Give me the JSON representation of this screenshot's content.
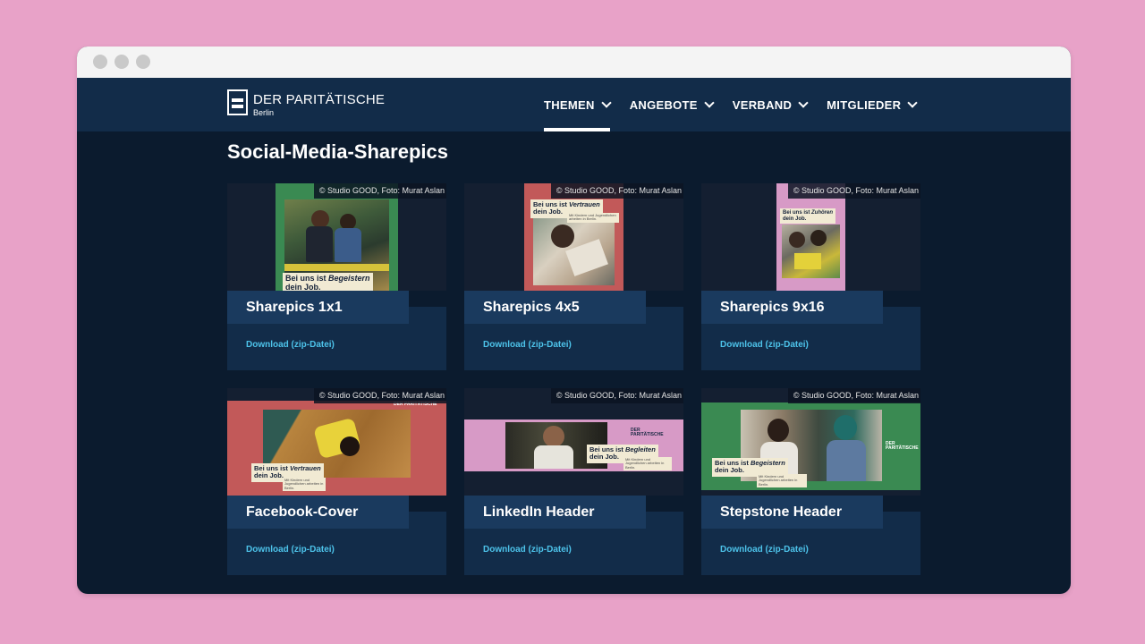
{
  "header": {
    "logo_name": "DER PARITÄTISCHE",
    "logo_sub": "Berlin"
  },
  "nav": [
    {
      "label": "THEMEN"
    },
    {
      "label": "ANGEBOTE"
    },
    {
      "label": "VERBAND"
    },
    {
      "label": "MITGLIEDER"
    }
  ],
  "page": {
    "title": "Social-Media-Sharepics"
  },
  "cards": [
    {
      "title": "Sharepics 1x1",
      "download": "Download (zip-Datei)",
      "credit": "© Studio GOOD, Foto: Murat Aslan",
      "tag_pre": "Bei uns ist ",
      "tag_em": "Begeistern",
      "tag_post": "dein Job."
    },
    {
      "title": "Sharepics 4x5",
      "download": "Download (zip-Datei)",
      "credit": "© Studio GOOD, Foto: Murat Aslan",
      "tag_pre": "Bei uns ist ",
      "tag_em": "Vertrauen",
      "tag_post": "dein Job."
    },
    {
      "title": "Sharepics 9x16",
      "download": "Download (zip-Datei)",
      "credit": "© Studio GOOD, Foto: Murat Aslan",
      "tag_pre": "Bei uns ist ",
      "tag_em": "Zuhören",
      "tag_post": "dein Job."
    },
    {
      "title": "Facebook-Cover",
      "download": "Download (zip-Datei)",
      "credit": "© Studio GOOD, Foto: Murat Aslan",
      "tag_pre": "Bei uns ist ",
      "tag_em": "Vertrauen",
      "tag_post": "dein Job."
    },
    {
      "title": "LinkedIn Header",
      "download": "Download (zip-Datei)",
      "credit": "© Studio GOOD, Foto: Murat Aslan",
      "tag_pre": "Bei uns ist ",
      "tag_em": "Begleiten",
      "tag_post": "dein Job."
    },
    {
      "title": "Stepstone Header",
      "download": "Download (zip-Datei)",
      "credit": "© Studio GOOD, Foto: Murat Aslan",
      "tag_pre": "Bei uns ist ",
      "tag_em": "Begeistern",
      "tag_post": "dein Job."
    }
  ],
  "art_small_text": "Mit Kindern und Jugendlichen arbeiten in Berlin.",
  "colors": {
    "page_background": "#e8a2c8",
    "header": "#122c49",
    "content_background": "#0b1b2e",
    "link": "#4dc3ea",
    "art_green": "#3a8a52",
    "art_red": "#c25959",
    "art_pink": "#d79ac6"
  },
  "icons": [
    "chevron-down-icon",
    "window-dot-icon"
  ]
}
